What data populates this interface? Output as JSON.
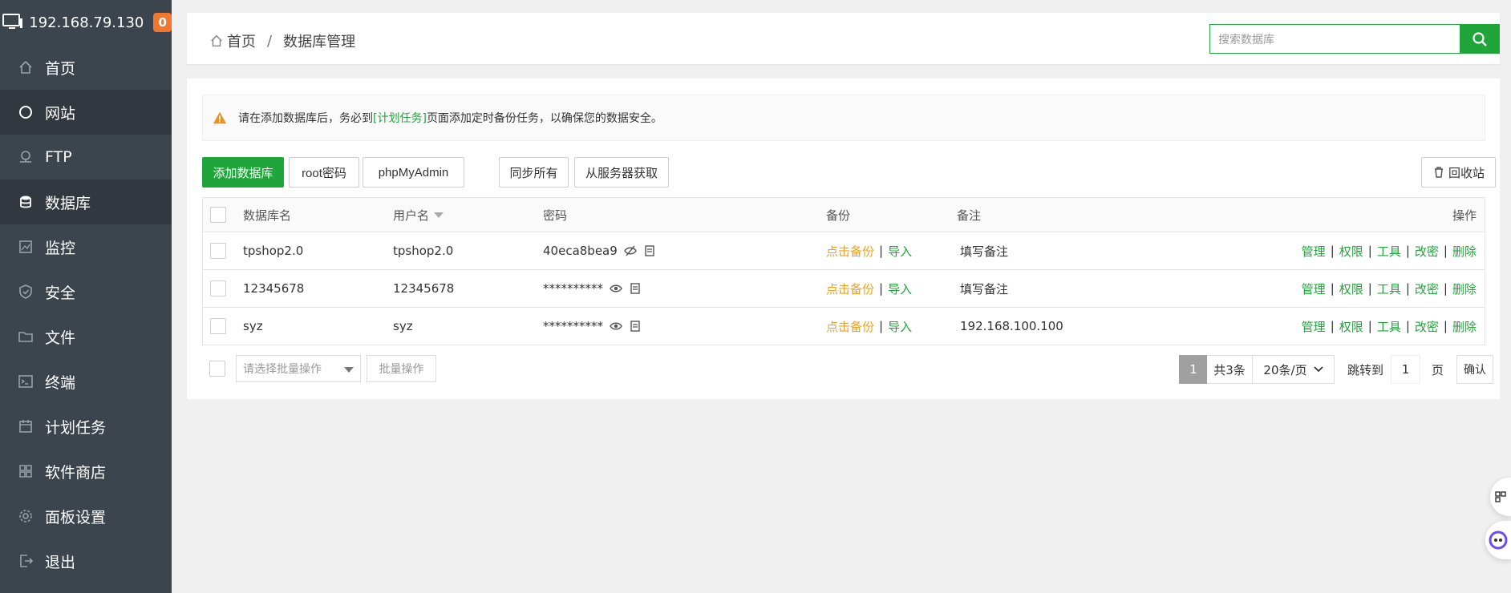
{
  "sidebar": {
    "ip": "192.168.79.130",
    "badge": "0",
    "items": [
      {
        "label": "首页"
      },
      {
        "label": "网站"
      },
      {
        "label": "FTP"
      },
      {
        "label": "数据库"
      },
      {
        "label": "监控"
      },
      {
        "label": "安全"
      },
      {
        "label": "文件"
      },
      {
        "label": "终端"
      },
      {
        "label": "计划任务"
      },
      {
        "label": "软件商店"
      },
      {
        "label": "面板设置"
      },
      {
        "label": "退出"
      }
    ]
  },
  "header": {
    "breadcrumb_home": "首页",
    "breadcrumb_sep": "/",
    "breadcrumb_current": "数据库管理",
    "search_placeholder": "搜索数据库"
  },
  "notice": {
    "text_before": "请在添加数据库后，务必到",
    "link": "[计划任务]",
    "text_after": "页面添加定时备份任务，以确保您的数据安全。"
  },
  "toolbar": {
    "add": "添加数据库",
    "root_pwd": "root密码",
    "phpmyadmin": "phpMyAdmin",
    "sync_all": "同步所有",
    "fetch": "从服务器获取",
    "recycle": "回收站"
  },
  "table": {
    "headers": {
      "name": "数据库名",
      "user": "用户名",
      "password": "密码",
      "backup": "备份",
      "note": "备注",
      "ops": "操作"
    },
    "rows": [
      {
        "name": "tpshop2.0",
        "user": "tpshop2.0",
        "password": "40eca8bea9",
        "backup": "点击备份",
        "import": "导入",
        "note": "填写备注"
      },
      {
        "name": "12345678",
        "user": "12345678",
        "password": "**********",
        "backup": "点击备份",
        "import": "导入",
        "note": "填写备注"
      },
      {
        "name": "syz",
        "user": "syz",
        "password": "**********",
        "backup": "点击备份",
        "import": "导入",
        "note": "192.168.100.100"
      }
    ],
    "ops": {
      "manage": "管理",
      "perm": "权限",
      "tools": "工具",
      "chpwd": "改密",
      "delete": "删除"
    }
  },
  "footer": {
    "batch_placeholder": "请选择批量操作",
    "batch_btn": "批量操作",
    "page_current": "1",
    "total": "共3条",
    "per_page": "20条/页",
    "goto_label": "跳转到",
    "goto_value": "1",
    "page_label": "页",
    "confirm": "确认"
  },
  "colors": {
    "accent": "#20a53a",
    "sidebar": "#3c444d",
    "backup_link": "#f0a020",
    "badge": "#f0772d"
  }
}
